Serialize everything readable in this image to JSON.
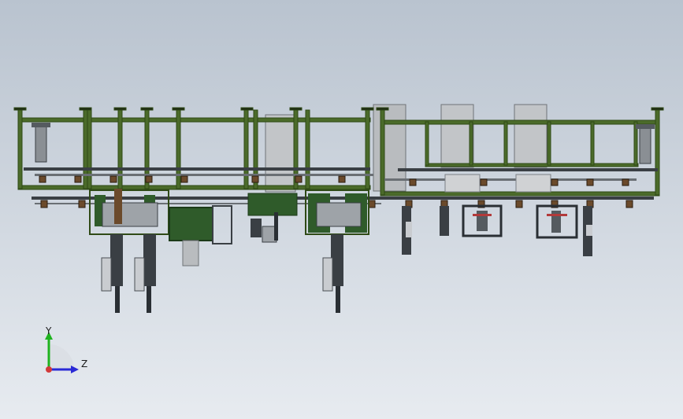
{
  "viewport": {
    "background_top": "#b9c3cf",
    "background_bottom": "#e7ebf0",
    "model_colors": {
      "frame_green": "#4b6b2a",
      "frame_green_dark": "#2f4a16",
      "panel_green": "#2f5b2a",
      "steel_dark": "#3a3f44",
      "steel_mid": "#7b8086",
      "steel_light": "#c9ccd0",
      "column_gray": "#b9bcbf",
      "accent_brown": "#6b4a2b",
      "accent_red": "#b23a3a"
    }
  },
  "triad": {
    "y_label": "Y",
    "z_label": "Z",
    "y_color": "#1fb31f",
    "z_color": "#2a2ad6",
    "origin_color": "#d23a3a"
  }
}
